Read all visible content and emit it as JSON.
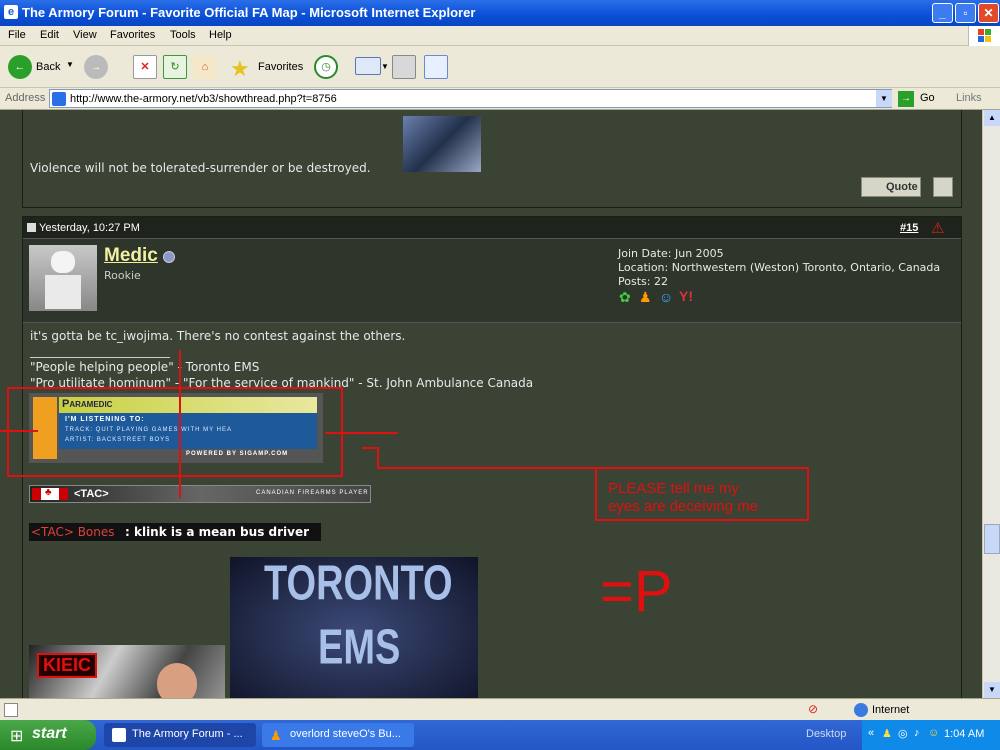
{
  "window": {
    "title": "The Armory Forum - Favorite Official FA Map - Microsoft Internet Explorer"
  },
  "menu": [
    "File",
    "Edit",
    "View",
    "Favorites",
    "Tools",
    "Help"
  ],
  "toolbar": {
    "back": "Back",
    "favorites": "Favorites"
  },
  "address": {
    "label": "Address",
    "url": "http://www.the-armory.net/vb3/showthread.php?t=8756",
    "go": "Go",
    "links": "Links"
  },
  "prev_post": {
    "text": "Violence will not be tolerated-surrender or be destroyed.",
    "quote": "Quote"
  },
  "post": {
    "date": "Yesterday, 10:27 PM",
    "number": "#15",
    "username": "Medic",
    "rank": "Rookie",
    "join": "Join Date: Jun 2005",
    "location": "Location: Northwestern (Weston) Toronto, Ontario, Canada",
    "posts": "Posts: 22",
    "body": "it's gotta be tc_iwojima. There's no contest against the others.",
    "sig1": "\"People helping people\" - Toronto EMS",
    "sig2": "\"Pro utilitate hominum\" - \"For the service of mankind\" - St. John Ambulance Canada",
    "sigamp_title": "Paramedic",
    "sigamp_listen": "I'M LISTENING TO:",
    "sigamp_track": "TRACK: QUIT PLAYING GAMES WITH MY HEA",
    "sigamp_artist": "ARTIST: BACKSTREET BOYS",
    "sigamp_powered": "POWERED BY SIGAMP.COM",
    "tac_tag": "<TAC>",
    "tac_sub": "CANADIAN FIREARMS PLAYER",
    "quote_tag": "<TAC> Bones",
    "quote_text": ": klink is a mean bus driver",
    "ems_line1": "TORONTO",
    "ems_line2": "EMS",
    "kfc": "KIEIC"
  },
  "annotation": {
    "line1": "PLEASE tell me my",
    "line2": "eyes are deceiving me",
    "face": "=P"
  },
  "status": {
    "zone": "Internet"
  },
  "taskbar": {
    "start": "start",
    "task1": "The Armory Forum - ...",
    "task2": "overlord steveO's Bu...",
    "desktop": "Desktop",
    "clock": "1:04 AM"
  },
  "colors": {
    "accent_red": "#e01010",
    "link_yellow": "#f0f0a0"
  }
}
